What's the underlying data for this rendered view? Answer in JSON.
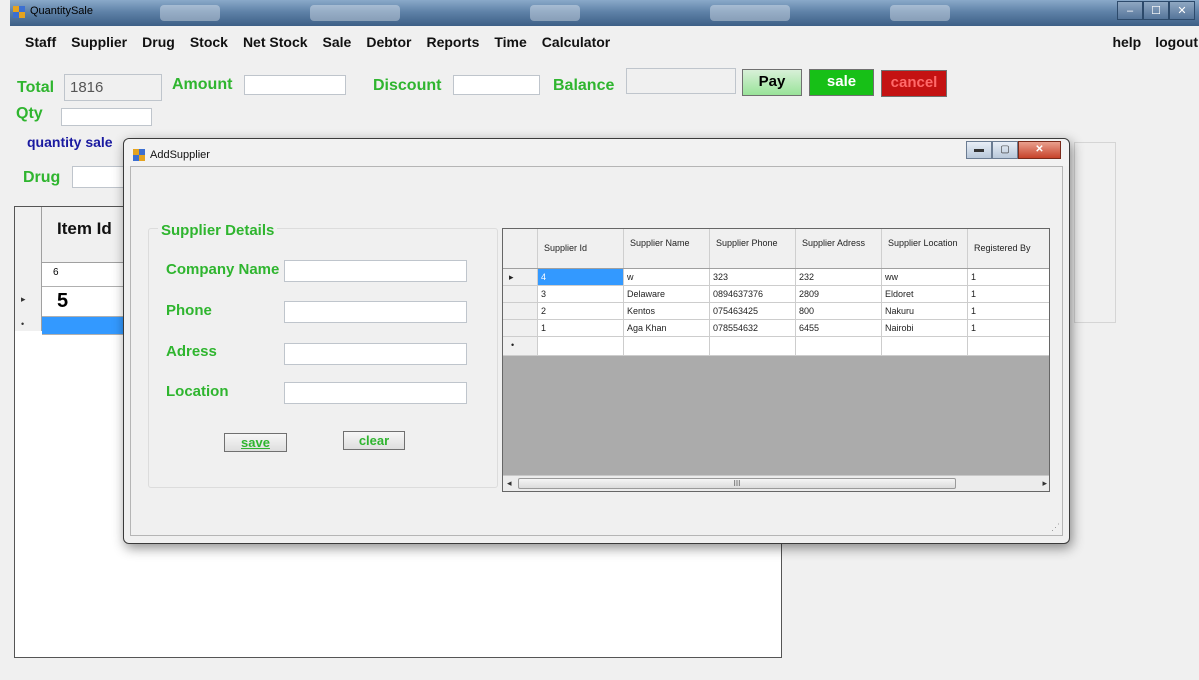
{
  "window": {
    "title": "QuantitySale",
    "controls": [
      "–",
      "☐",
      "✕"
    ]
  },
  "menu": {
    "left": [
      "Staff",
      "Supplier",
      "Drug",
      "Stock",
      "Net Stock",
      "Sale",
      "Debtor",
      "Reports",
      "Time",
      "Calculator"
    ],
    "right": [
      "help",
      "logout"
    ]
  },
  "form": {
    "total_label": "Total",
    "total_value": "1816",
    "amount_label": "Amount",
    "amount_value": "",
    "discount_label": "Discount",
    "discount_value": "",
    "balance_label": "Balance",
    "balance_value": "",
    "pay_button": "Pay",
    "sale_button": "sale",
    "cancel_button": "cancel",
    "qty_label": "Qty",
    "qty_value": "",
    "quantity_sale_label": "quantity sale",
    "drug_label": "Drug",
    "drug_value": ""
  },
  "background_grid": {
    "header": "Item Id",
    "row1": "6",
    "row2": "5"
  },
  "dialog": {
    "title": "AddSupplier",
    "controls": [
      "▬",
      "▢",
      "✕"
    ],
    "group_title": "Supplier Details",
    "fields": [
      {
        "label": "Company Name",
        "value": ""
      },
      {
        "label": "Phone",
        "value": ""
      },
      {
        "label": "Adress",
        "value": ""
      },
      {
        "label": "Location",
        "value": ""
      }
    ],
    "save_button": "save",
    "clear_button": "clear",
    "grid": {
      "columns": [
        "Supplier Id",
        "Supplier Name",
        "Supplier Phone",
        "Supplier Adress",
        "Supplier Location",
        "Registered By"
      ],
      "rows": [
        [
          "4",
          "w",
          "323",
          "232",
          "ww",
          "1"
        ],
        [
          "3",
          "Delaware",
          "0894637376",
          "2809",
          "Eldoret",
          "1"
        ],
        [
          "2",
          "Kentos",
          "075463425",
          "800",
          "Nakuru",
          "1"
        ],
        [
          "1",
          "Aga Khan",
          "078554632",
          "6455",
          "Nairobi",
          "1"
        ]
      ],
      "scroll_thumb": "III",
      "scroll_left": "◂",
      "scroll_right": "▸"
    },
    "resize_grip": "⋰"
  },
  "colors": {
    "label_green": "#2fb52f",
    "sale_green": "#17c017",
    "cancel_red": "#c41212",
    "selection_blue": "#3399ff",
    "quantity_sale_blue": "#1a1aa0"
  }
}
